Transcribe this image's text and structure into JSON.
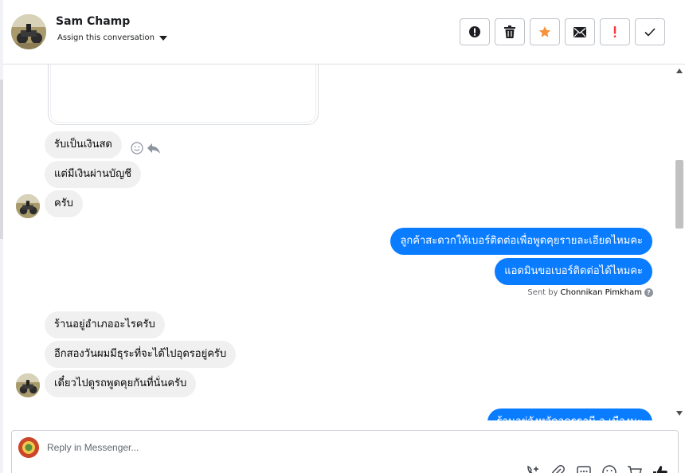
{
  "header": {
    "name": "Sam Champ",
    "assign_label": "Assign this conversation",
    "actions": [
      {
        "name": "report-spam-button",
        "icon": "exclamation-circle-icon"
      },
      {
        "name": "delete-button",
        "icon": "trash-icon"
      },
      {
        "name": "star-button",
        "icon": "star-icon",
        "color": "#f7923b"
      },
      {
        "name": "mark-unread-button",
        "icon": "envelope-icon"
      },
      {
        "name": "follow-up-button",
        "icon": "exclamation-icon",
        "color": "#fa383e"
      },
      {
        "name": "mark-done-button",
        "icon": "check-icon"
      }
    ]
  },
  "messages": {
    "in_1": "รับเป็นเงินสด",
    "in_2": "แต่มีเงินผ่านบัญชี",
    "in_3": "ครับ",
    "out_1": "ลูกค้าสะดวกให้เบอร์ติดต่อเพื่อพูดคุยรายละเอียดไหมคะ",
    "out_2": "แอดมินขอเบอร์ติดต่อได้ไหมคะ",
    "in_4": "ร้านอยู่อำเภออะไรครับ",
    "in_5": "อีกสองวันผมมีธุระที่จะได้ไปอุดรอยู่ครับ",
    "in_6": "เดี๋ยวไปดูรถพูดคุยกันที่นั่นครับ",
    "out_3": "ร้านอยู่จังหวัดอุดรธานี อ.เมืองนะ"
  },
  "sent_by": {
    "prefix": "Sent by",
    "agent": "Chonnikan Pimkham"
  },
  "composer": {
    "placeholder": "Reply in Messenger...",
    "tools": [
      "add-contact-icon",
      "attachment-icon",
      "saved-replies-icon",
      "emoji-icon",
      "cart-icon",
      "thumbs-up-icon"
    ]
  },
  "colors": {
    "outgoing_bubble": "#0a7cff",
    "incoming_bubble": "#f0f0f0",
    "star": "#f7923b",
    "alert": "#fa383e"
  }
}
